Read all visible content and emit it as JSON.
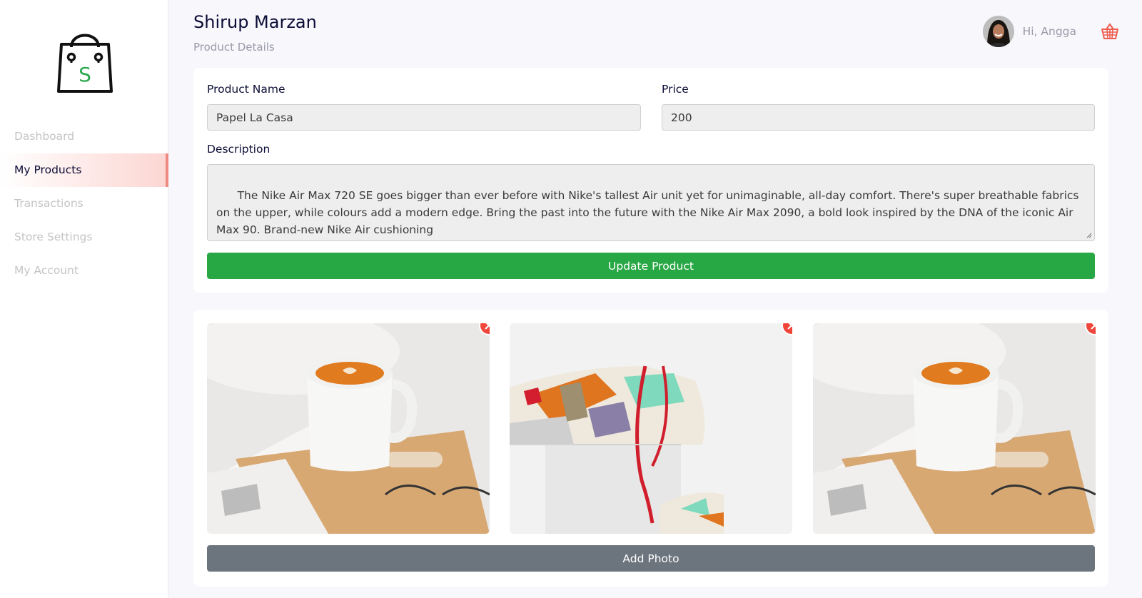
{
  "sidebar": {
    "logo_letter": "S",
    "items": [
      {
        "label": "Dashboard"
      },
      {
        "label": "My Products"
      },
      {
        "label": "Transactions"
      },
      {
        "label": "Store Settings"
      },
      {
        "label": "My Account"
      }
    ],
    "active_index": 1
  },
  "header": {
    "title": "Shirup Marzan",
    "subtitle": "Product Details",
    "greeting": "Hi, Angga"
  },
  "form": {
    "product_name_label": "Product Name",
    "product_name_value": "Papel La Casa",
    "price_label": "Price",
    "price_value": "200",
    "description_label": "Description",
    "description_value": "The Nike Air Max 720 SE goes bigger than ever before with Nike's tallest Air unit yet for unimaginable, all-day comfort. There's super breathable fabrics on the upper, while colours add a modern edge. Bring the past into the future with the Nike Air Max 2090, a bold look inspired by the DNA of the iconic Air Max 90. Brand-new Nike Air cushioning",
    "submit_label": "Update Product"
  },
  "photos": {
    "items": [
      {
        "subject": "coffee-cup-photo",
        "remove_icon": "close-icon"
      },
      {
        "subject": "sneaker-photo",
        "remove_icon": "close-icon"
      },
      {
        "subject": "coffee-cup-photo",
        "remove_icon": "close-icon"
      }
    ],
    "add_label": "Add Photo"
  },
  "colors": {
    "primary_green": "#28a745",
    "secondary_gray": "#6c757d",
    "accent_red": "#f0453a",
    "active_nav": "#fcd6d2"
  }
}
